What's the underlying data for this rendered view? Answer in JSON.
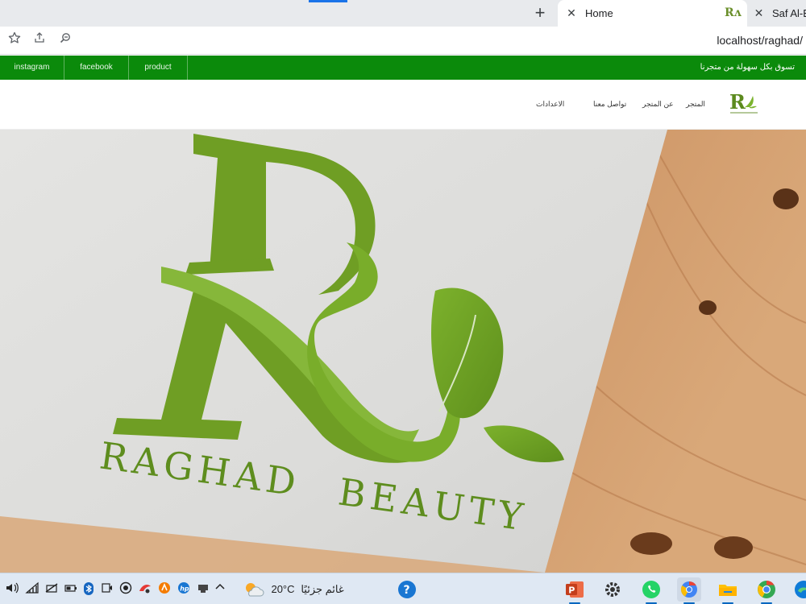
{
  "browser": {
    "new_tab_symbol": "+",
    "tabs": [
      {
        "title": "Home",
        "close": "✕",
        "favicon": "Rʌ"
      },
      {
        "title": "Saf Al-Ba",
        "close": "✕"
      }
    ],
    "url": "localhost/raghad/",
    "icons": [
      "star-icon",
      "share-icon",
      "zoom-icon"
    ]
  },
  "site": {
    "topbar": {
      "links": [
        "instagram",
        "facebook",
        "product"
      ],
      "promo": "تسوق بكل سهولة من متجرنا",
      "color": "#0b8a0b"
    },
    "nav": [
      "المتجر",
      "عن المتجر",
      "تواصل معنا",
      "الاعدادات"
    ],
    "hero": {
      "brand_line1": "RAGHAD",
      "brand_line2": "BEAUTY",
      "logo_color": "#6b9a1f"
    }
  },
  "taskbar": {
    "weather_temp": "20°C",
    "weather_text": "غائم جزئيًا",
    "tray_icons": [
      "volume-icon",
      "wifi-icon",
      "network-icon",
      "battery-icon",
      "bluetooth-icon",
      "meet-icon",
      "record-icon",
      "app-red-icon",
      "avast-icon",
      "hp-icon",
      "usb-icon",
      "chevron-up-icon"
    ],
    "apps": [
      "help-icon",
      "powerpoint-icon",
      "settings-icon",
      "whatsapp-icon",
      "browser-icon",
      "file-explorer-icon",
      "chrome-icon",
      "edge-icon"
    ]
  }
}
